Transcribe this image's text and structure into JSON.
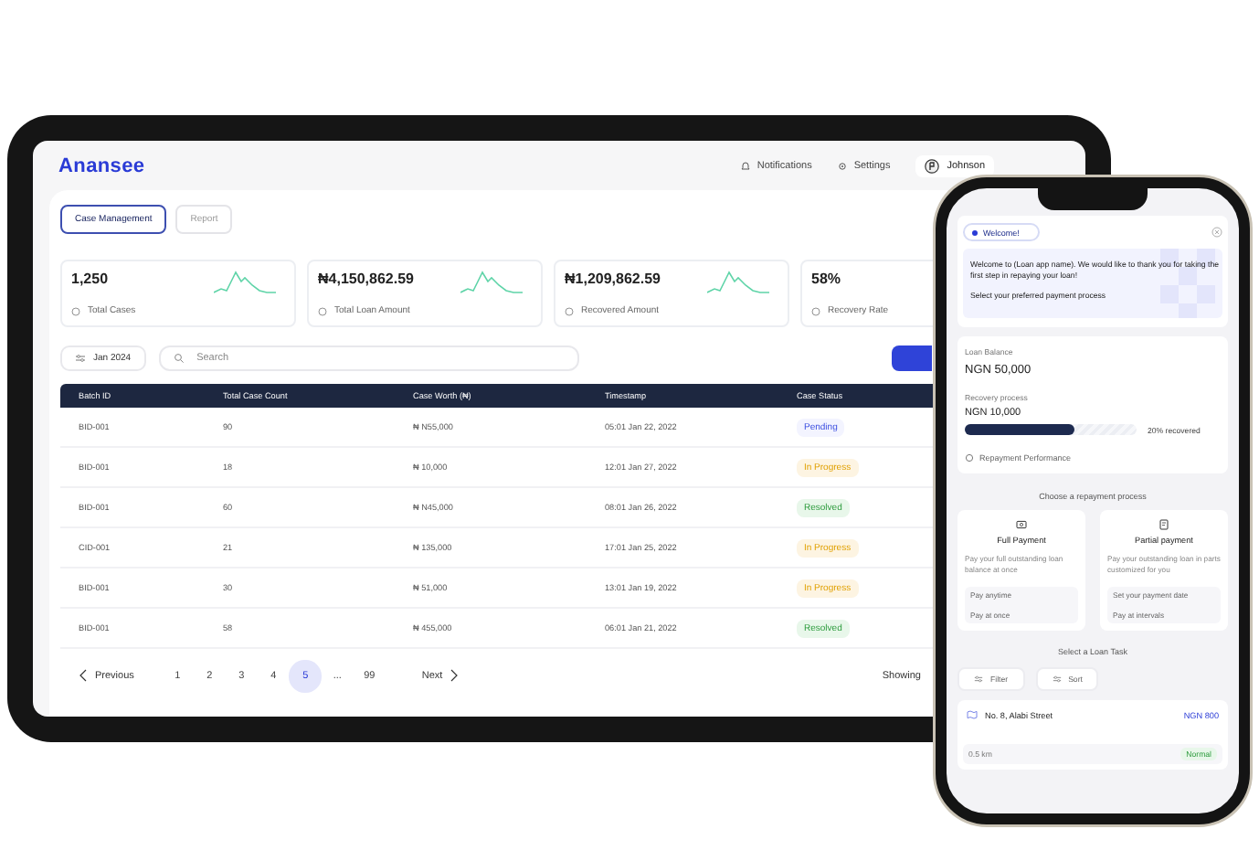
{
  "tablet": {
    "logo": "Anansee",
    "nav": [
      {
        "label": "Notifications",
        "kind": "bell"
      },
      {
        "label": "Settings",
        "kind": "gear"
      }
    ],
    "user": {
      "name": "Johnson"
    },
    "tabs": [
      {
        "label": "Case Management",
        "selected": true
      },
      {
        "label": "Report",
        "selected": false
      }
    ],
    "stats": [
      {
        "kind": "trend",
        "value": "1,250",
        "label": "Total Cases"
      },
      {
        "kind": "trend",
        "value": "₦4,150,862.59",
        "label": "Total Loan Amount"
      },
      {
        "kind": "trend",
        "value": "₦1,209,862.59",
        "label": "Recovered Amount"
      },
      {
        "kind": "rate",
        "value": "58%",
        "label": "Recovery Rate"
      }
    ],
    "filter": {
      "label": "Jan 2024"
    },
    "search": {
      "placeholder": "Search"
    },
    "table": {
      "columns": [
        "Batch ID",
        "Total Case Count",
        "Case Worth (₦)",
        "Timestamp",
        "Case Status"
      ],
      "rows": [
        {
          "cells": [
            "BID-001",
            "90",
            "₦ N55,000",
            "05:01 Jan 22, 2022"
          ],
          "status": "Pending",
          "kind": "pending"
        },
        {
          "cells": [
            "BID-001",
            "18",
            "₦ 10,000",
            "12:01 Jan 27, 2022"
          ],
          "status": "In Progress",
          "kind": "progress"
        },
        {
          "cells": [
            "BID-001",
            "60",
            "₦ N45,000",
            "08:01 Jan 26, 2022"
          ],
          "status": "Resolved",
          "kind": "resolved"
        },
        {
          "cells": [
            "CID-001",
            "21",
            "₦ 135,000",
            "17:01 Jan 25, 2022"
          ],
          "status": "In Progress",
          "kind": "progress"
        },
        {
          "cells": [
            "BID-001",
            "30",
            "₦ 51,000",
            "13:01 Jan 19, 2022"
          ],
          "status": "In Progress",
          "kind": "progress"
        },
        {
          "cells": [
            "BID-001",
            "58",
            "₦ 455,000",
            "06:01 Jan 21, 2022"
          ],
          "status": "Resolved",
          "kind": "resolved"
        }
      ]
    },
    "pagination": {
      "previous": "Previous",
      "next": "Next",
      "showing": "Showing",
      "pages": [
        {
          "label": "1",
          "selected": false
        },
        {
          "label": "2",
          "selected": false
        },
        {
          "label": "3",
          "selected": false
        },
        {
          "label": "4",
          "selected": false
        },
        {
          "label": "5",
          "selected": true
        },
        {
          "label": "...",
          "selected": false
        },
        {
          "label": "99",
          "selected": false
        }
      ]
    }
  },
  "phone": {
    "badge": "Welcome!",
    "message": "Welcome to (Loan app name). We would like to thank you for taking the first step in repaying your loan!",
    "prompt": "Select your preferred payment process",
    "loan": {
      "balance_label": "Loan Balance",
      "balance": "NGN 50,000",
      "recovery_label": "Recovery process",
      "recovery_amount": "NGN 10,000",
      "level": 0.64,
      "reading": "20% recovered",
      "link": "Repayment Performance"
    },
    "choose_title": "Choose a repayment process",
    "options": [
      {
        "kind": "full",
        "title": "Full Payment",
        "description": "Pay your full outstanding loan balance at once",
        "features": [
          "Pay anytime",
          "Pay at once"
        ]
      },
      {
        "kind": "partial",
        "title": "Partial payment",
        "description": "Pay your outstanding loan in parts customized for you",
        "features": [
          "Set your payment date",
          "Pay at intervals"
        ]
      }
    ],
    "task_title": "Select a Loan Task",
    "task_buttons": [
      "Filter",
      "Sort"
    ],
    "task": {
      "address": "No. 8, Alabi Street",
      "amount": "NGN 800",
      "distance": "0.5 km",
      "priority": "Normal"
    }
  }
}
